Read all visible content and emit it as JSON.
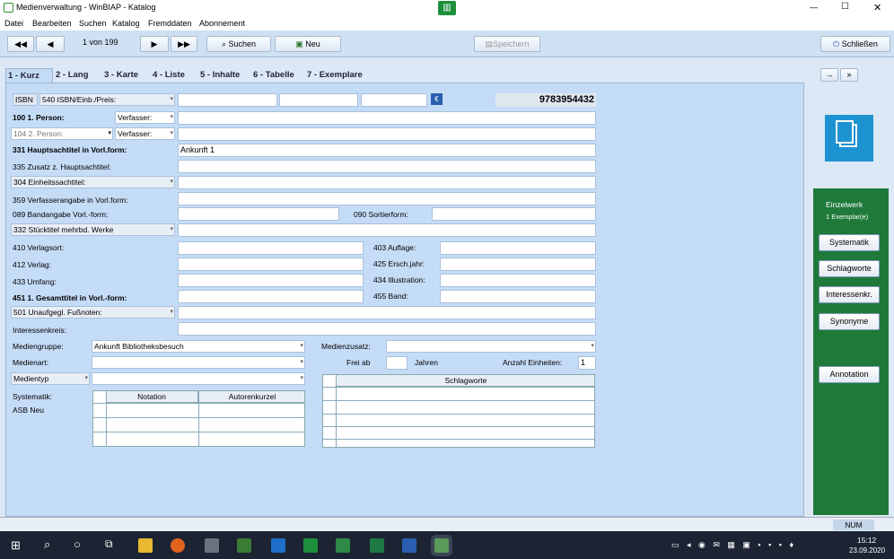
{
  "window": {
    "title": "Medienverwaltung - WinBIAP - Katalog",
    "min": "—",
    "max": "☐",
    "close": "✕"
  },
  "menu": [
    "Datei",
    "Bearbeiten",
    "Suchen",
    "Katalog",
    "Fremddaten",
    "Abonnement"
  ],
  "toolbar": {
    "first": "◀◀",
    "prev": "◀",
    "record": "1 von 199",
    "next": "▶",
    "last": "▶▶",
    "search": "Suchen",
    "new": "Neu",
    "save": "Speichern",
    "close": "Schließen"
  },
  "tabs": [
    "1 - Kurz",
    "2 - Lang",
    "3 - Karte",
    "4 - Liste",
    "5 - Inhalte",
    "6 - Tabelle",
    "7 - Exemplare"
  ],
  "form": {
    "isbn_btn": "ISBN",
    "isbn_lbl": "540  ISBN/Einb./Preis:",
    "isbn_value": "9783954432",
    "p1_lbl": "100  1. Person:",
    "p1_role": "Verfasser:",
    "p2_lbl": "104  2. Person:",
    "p2_role": "Verfasser:",
    "title_lbl": "331  Hauptsachtitel in Vorl.form:",
    "title_value": "Ankunft 1",
    "zusatz_lbl": "335  Zusatz z. Hauptsachtitel:",
    "einheit_lbl": "304  Einheitssachtitel:",
    "verfasser_lbl": "359  Verfasserangabe in Vorl.form:",
    "band_lbl": "089  Bandangabe Vorl.-form:",
    "sort_lbl": "090  Sortierform:",
    "stueck_lbl": "332  Stücktitel mehrbd. Werke",
    "ort_lbl": "410  Verlagsort:",
    "aufl_lbl": "403  Auflage:",
    "verlag_lbl": "412  Verlag:",
    "jahr_lbl": "425  Ersch.jahr:",
    "umfang_lbl": "433  Umfang:",
    "illu_lbl": "434  Illustration:",
    "gesamt_lbl": "451  1. Gesamttitel in Vorl.-form:",
    "bandn_lbl": "455  Band:",
    "fuss_lbl": "501  Unaufgegl. Fußnoten:",
    "interessen_lbl": "Interessenkreis:",
    "mgruppe_lbl": "Mediengruppe:",
    "mgruppe_value": "Ankunft Bibliotheksbesuch",
    "mzusatz_lbl": "Medienzusatz:",
    "mart_lbl": "Medienart:",
    "frei_lbl": "Frei ab",
    "jahren_lbl": "Jahren",
    "anzahl_lbl": "Anzahl Einheiten:",
    "anzahl_value": "1",
    "mtyp_lbl": "Medientyp",
    "syst_lbl": "Systematik:",
    "syst_value": "ASB Neu",
    "col_notation": "Notation",
    "col_autor": "Autorenkurzel",
    "col_schlag": "Schlagworte"
  },
  "side": {
    "nav1": "→",
    "nav2": "»",
    "einzel": "Einzelwerk",
    "exemplar": "1 Exemplar(e)",
    "buttons": [
      "Systematik",
      "Schlagworte",
      "Interessenkr.",
      "Synonyme"
    ],
    "annotation": "Annotation"
  },
  "status": {
    "num": "NUM"
  },
  "taskbar": {
    "time": "15:12",
    "date": "23.09.2020"
  }
}
